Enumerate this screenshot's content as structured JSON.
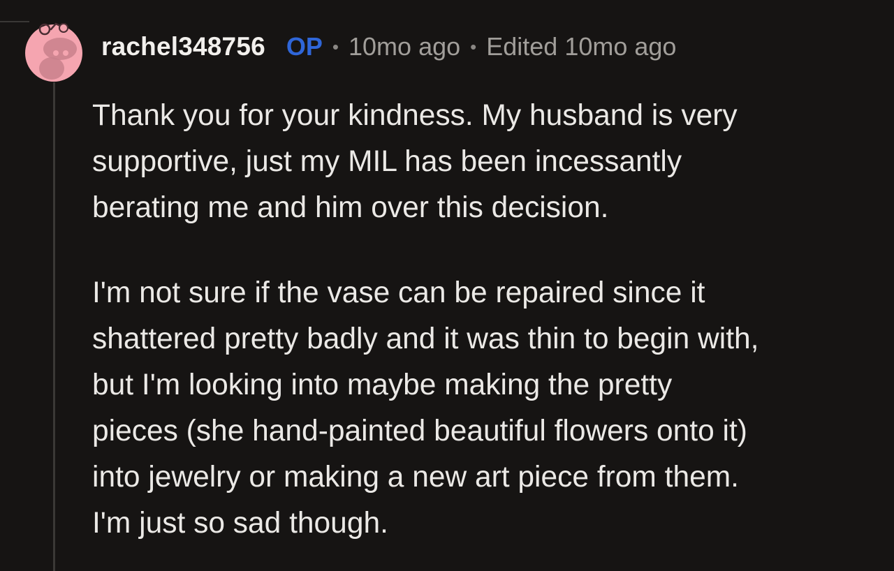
{
  "comment": {
    "author": "rachel348756",
    "op_badge": "OP",
    "separator": "•",
    "posted": "10mo ago",
    "edited": "Edited 10mo ago",
    "avatar_icon": "snoo-avatar-icon",
    "avatar_color": "#f5a5b0",
    "paragraphs": [
      {
        "lines": [
          "Thank you for your kindness. My husband is very",
          "supportive, just my MIL has been incessantly",
          "berating me and him over this decision."
        ]
      },
      {
        "lines": [
          "I'm not sure if the vase can be repaired since it",
          "shattered pretty badly and it was thin to begin with,",
          "but I'm looking into maybe making the pretty",
          "pieces (she hand-painted beautiful flowers onto it)",
          "into jewelry or making a new art piece from them.",
          "I'm just so sad though."
        ]
      }
    ]
  }
}
